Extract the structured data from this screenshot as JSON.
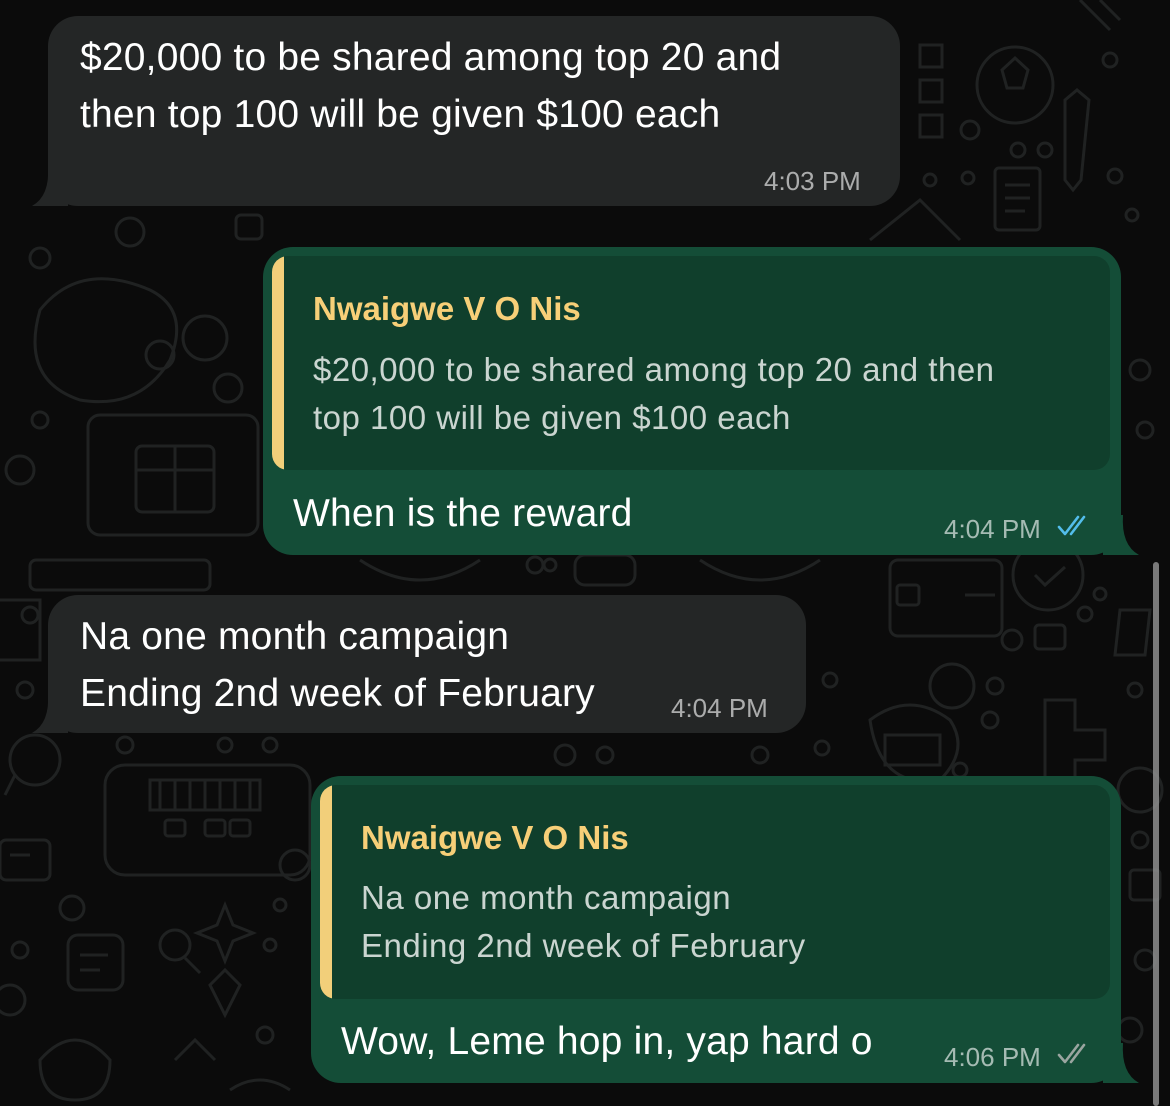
{
  "colors": {
    "background": "#0b0b0b",
    "incoming_bubble": "#242626",
    "outgoing_bubble": "#144d37",
    "quote_background": "#103f2c",
    "quote_author": "#f7cf78",
    "read_ticks": "#53bdeb",
    "delivered_ticks": "#9aa5a0"
  },
  "messages": [
    {
      "direction": "incoming",
      "lines": [
        "$20,000 to be shared among top 20 and",
        "then top 100 will be given $100 each"
      ],
      "time": "4:03 PM"
    },
    {
      "direction": "outgoing",
      "quote": {
        "author": "Nwaigwe V O Nis",
        "lines": [
          "$20,000 to be shared among top 20 and then",
          "top 100 will be given $100 each"
        ]
      },
      "lines": [
        "When is the reward"
      ],
      "time": "4:04 PM",
      "status_icon": "read-ticks-icon"
    },
    {
      "direction": "incoming",
      "lines": [
        "Na one month campaign",
        "Ending 2nd week of February"
      ],
      "time": "4:04 PM"
    },
    {
      "direction": "outgoing",
      "quote": {
        "author": "Nwaigwe V O Nis",
        "lines": [
          "Na one month campaign",
          "Ending 2nd week of February"
        ]
      },
      "lines": [
        "Wow, Leme hop in, yap hard o"
      ],
      "time": "4:06 PM",
      "status_icon": "delivered-ticks-icon"
    }
  ]
}
